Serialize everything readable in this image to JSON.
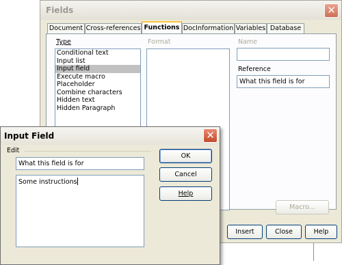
{
  "fields_dialog": {
    "title": "Fields",
    "tabs": [
      "Document",
      "Cross-references",
      "Functions",
      "DocInformation",
      "Variables",
      "Database"
    ],
    "active_tab": "Functions",
    "type_label": "Type",
    "format_label": "Format",
    "name_label": "Name",
    "reference_label": "Reference",
    "reference_value": "What this field is for",
    "name_value": "",
    "type_items": [
      "Conditional text",
      "Input list",
      "Input field",
      "Execute macro",
      "Placeholder",
      "Combine characters",
      "Hidden text",
      "Hidden Paragraph"
    ],
    "selected_type": "Input field",
    "macro_button": "Macro...",
    "insert_button": "Insert",
    "close_button": "Close",
    "help_button": "Help"
  },
  "input_field_dialog": {
    "title": "Input Field",
    "group_label": "Edit",
    "reference_text": "What this field is for",
    "content_text": "Some instructions",
    "ok_button": "OK",
    "cancel_button": "Cancel",
    "help_button": "Help"
  },
  "colors": {
    "dialog_bg": "#ece9d8",
    "selection_bg": "#c1c1c1",
    "active_tab_accent": "#ffc83c",
    "close_button": "#c44a2b"
  },
  "icons": [
    "close-icon"
  ]
}
